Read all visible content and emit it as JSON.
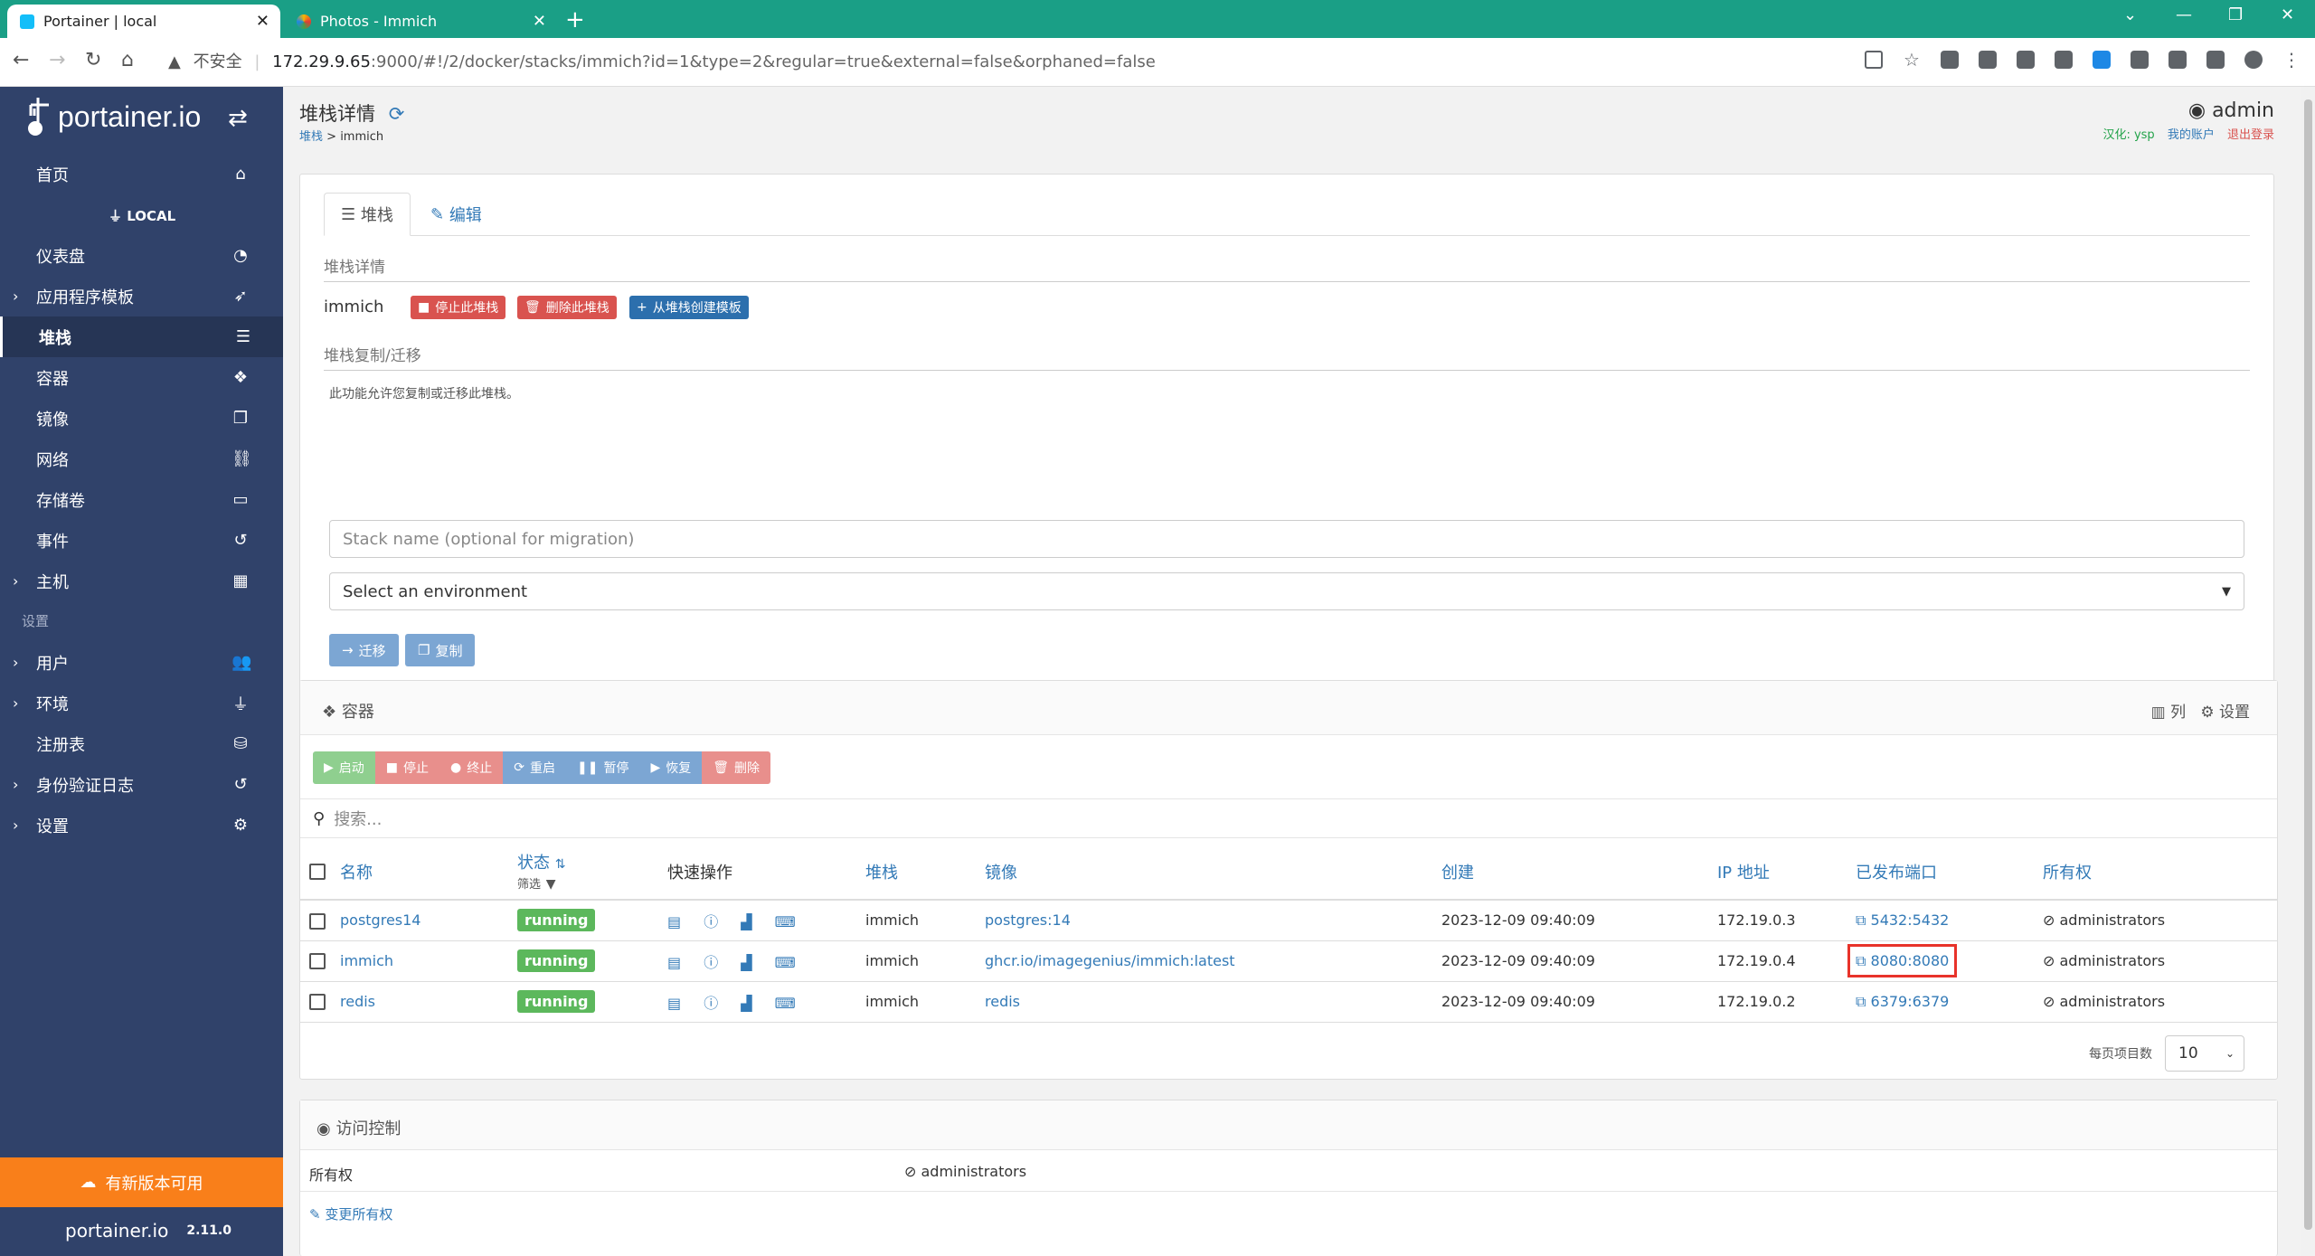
{
  "browser": {
    "tabs": [
      {
        "title": "Portainer | local"
      },
      {
        "title": "Photos - Immich"
      }
    ],
    "url_warning": "不安全",
    "url_host": "172.29.9.65",
    "url_rest": ":9000/#!/2/docker/stacks/immich?id=1&type=2&regular=true&external=false&orphaned=false"
  },
  "sidebar": {
    "logo": "portainer.io",
    "home": "首页",
    "env_header": "LOCAL",
    "items": [
      {
        "label": "仪表盘",
        "expand": false
      },
      {
        "label": "应用程序模板",
        "expand": true
      },
      {
        "label": "堆栈",
        "expand": false,
        "active": true
      },
      {
        "label": "容器",
        "expand": false
      },
      {
        "label": "镜像",
        "expand": false
      },
      {
        "label": "网络",
        "expand": false
      },
      {
        "label": "存储卷",
        "expand": false
      },
      {
        "label": "事件",
        "expand": false
      },
      {
        "label": "主机",
        "expand": true
      }
    ],
    "settings_header": "设置",
    "settings_items": [
      {
        "label": "用户",
        "expand": true
      },
      {
        "label": "环境",
        "expand": true
      },
      {
        "label": "注册表",
        "expand": false
      },
      {
        "label": "身份验证日志",
        "expand": true
      },
      {
        "label": "设置",
        "expand": true
      }
    ],
    "update_label": "有新版本可用",
    "footer_logo": "portainer.io",
    "version": "2.11.0"
  },
  "header": {
    "title": "堆栈详情",
    "breadcrumb_link": "堆栈",
    "breadcrumb_sep": " > ",
    "breadcrumb_current": "immich",
    "username": "admin",
    "link_translate": "汉化: ysp",
    "link_account": "我的账户",
    "link_logout": "退出登录"
  },
  "stack_panel": {
    "tab_stack": "堆栈",
    "tab_edit": "编辑",
    "details_title": "堆栈详情",
    "stack_name": "immich",
    "btn_stop": "停止此堆栈",
    "btn_delete": "删除此堆栈",
    "btn_template": "从堆栈创建模板",
    "migrate_title": "堆栈复制/迁移",
    "migrate_help": "此功能允许您复制或迁移此堆栈。",
    "name_placeholder": "Stack name (optional for migration)",
    "env_select": "Select an environment",
    "btn_migrate": "迁移",
    "btn_copy": "复制"
  },
  "containers": {
    "title": "容器",
    "columns_label": "列",
    "settings_label": "设置",
    "actions": [
      {
        "label": "启动",
        "color": "#8fcf8f"
      },
      {
        "label": "停止",
        "color": "#e88f8c"
      },
      {
        "label": "终止",
        "color": "#e88f8c"
      },
      {
        "label": "重启",
        "color": "#7ca6d3"
      },
      {
        "label": "暂停",
        "color": "#7ca6d3"
      },
      {
        "label": "恢复",
        "color": "#7ca6d3"
      },
      {
        "label": "删除",
        "color": "#e88f8c"
      }
    ],
    "search_placeholder": "搜索...",
    "headers": {
      "name": "名称",
      "state": "状态",
      "filter": "筛选",
      "quick": "快速操作",
      "stack": "堆栈",
      "image": "镜像",
      "created": "创建",
      "ip": "IP 地址",
      "ports": "已发布端口",
      "ownership": "所有权"
    },
    "rows": [
      {
        "name": "postgres14",
        "state": "running",
        "stack": "immich",
        "image": "postgres:14",
        "created": "2023-12-09 09:40:09",
        "ip": "172.19.0.3",
        "port": "5432:5432",
        "owner": "administrators"
      },
      {
        "name": "immich",
        "state": "running",
        "stack": "immich",
        "image": "ghcr.io/imagegenius/immich:latest",
        "created": "2023-12-09 09:40:09",
        "ip": "172.19.0.4",
        "port": "8080:8080",
        "owner": "administrators",
        "highlight": true
      },
      {
        "name": "redis",
        "state": "running",
        "stack": "immich",
        "image": "redis",
        "created": "2023-12-09 09:40:09",
        "ip": "172.19.0.2",
        "port": "6379:6379",
        "owner": "administrators"
      }
    ],
    "per_page_label": "每页项目数",
    "per_page": "10"
  },
  "access": {
    "title": "访问控制",
    "ownership_label": "所有权",
    "ownership_value": "administrators",
    "change_link": "变更所有权"
  },
  "colors": {
    "sidebar": "#30426a",
    "tabbar": "#1a9f86",
    "accent": "#337ab7",
    "danger": "#d9534f",
    "success": "#5cb85c",
    "update": "#f97f1a"
  }
}
